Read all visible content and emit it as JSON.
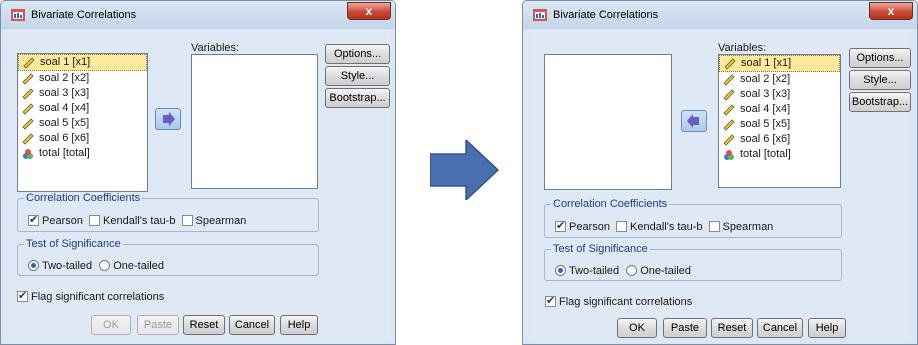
{
  "dialogs": [
    {
      "title": "Bivariate Correlations",
      "close_label": "x",
      "source_items": [
        "soal 1 [x1]",
        "soal 2 [x2]",
        "soal 3 [x3]",
        "soal 4 [x4]",
        "soal 5 [x5]",
        "soal 6 [x6]",
        "total [total]"
      ],
      "target_items": [],
      "variables_label": "Variables:",
      "side_buttons": [
        "Options...",
        "Style...",
        "Bootstrap..."
      ],
      "correlation": {
        "legend": "Correlation Coefficients",
        "options": [
          "Pearson",
          "Kendall's tau-b",
          "Spearman"
        ],
        "checked": [
          true,
          false,
          false
        ]
      },
      "significance": {
        "legend": "Test of Significance",
        "options": [
          "Two-tailed",
          "One-tailed"
        ],
        "selected": 0
      },
      "flag_label": "Flag significant correlations",
      "bottom_buttons": [
        "OK",
        "Paste",
        "Reset",
        "Cancel",
        "Help"
      ],
      "bottom_disabled": [
        true,
        true,
        false,
        false,
        false
      ]
    },
    {
      "title": "Bivariate Correlations",
      "close_label": "x",
      "source_items": [],
      "target_items": [
        "soal 1 [x1]",
        "soal 2 [x2]",
        "soal 3 [x3]",
        "soal 4 [x4]",
        "soal 5 [x5]",
        "soal 6 [x6]",
        "total [total]"
      ],
      "variables_label": "Variables:",
      "side_buttons": [
        "Options...",
        "Style...",
        "Bootstrap..."
      ],
      "correlation": {
        "legend": "Correlation Coefficients",
        "options": [
          "Pearson",
          "Kendall's tau-b",
          "Spearman"
        ],
        "checked": [
          true,
          false,
          false
        ]
      },
      "significance": {
        "legend": "Test of Significance",
        "options": [
          "Two-tailed",
          "One-tailed"
        ],
        "selected": 0
      },
      "flag_label": "Flag significant correlations",
      "bottom_buttons": [
        "OK",
        "Paste",
        "Reset",
        "Cancel",
        "Help"
      ],
      "bottom_disabled": [
        false,
        false,
        false,
        false,
        false
      ]
    }
  ],
  "colors": {
    "dialog_bg": "#dfe8f5",
    "selected": "#fde89b",
    "arrow_blue": "#4a6fb0"
  }
}
